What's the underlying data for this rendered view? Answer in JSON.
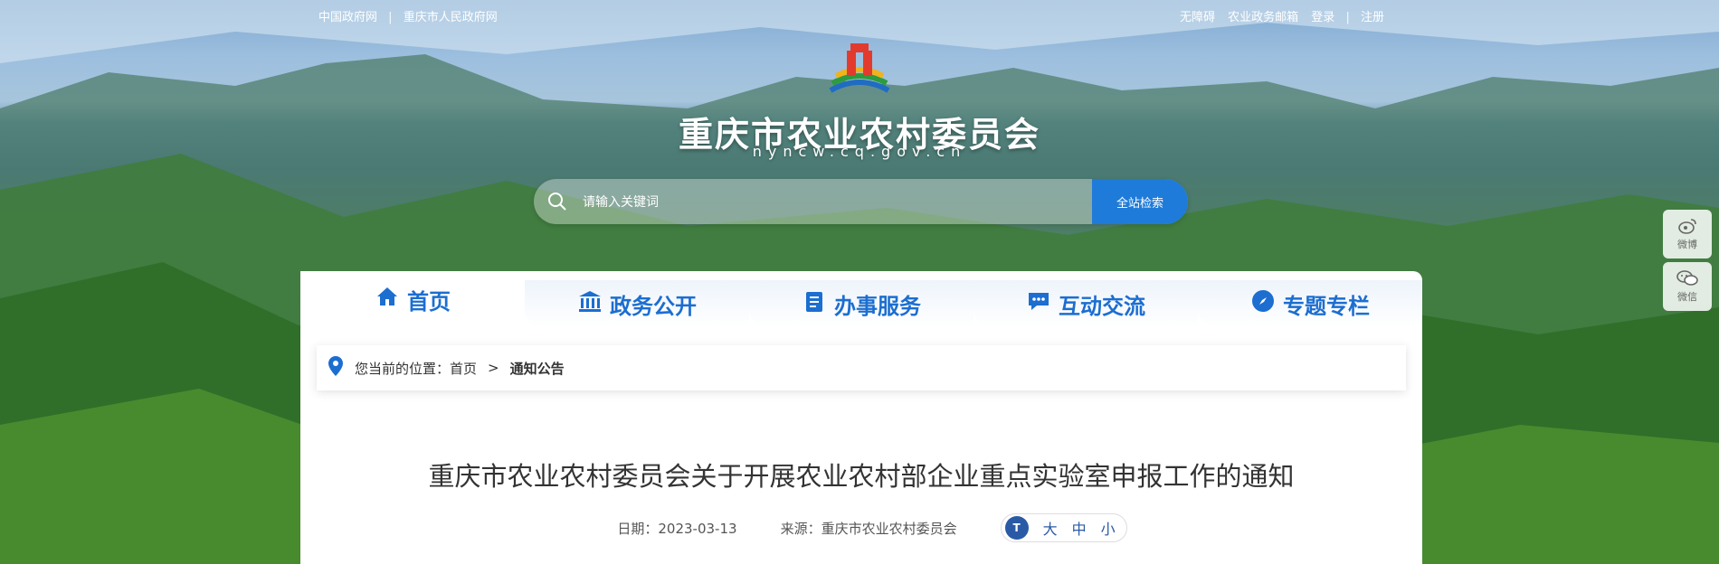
{
  "top_left_links": [
    "中国政府网",
    "重庆市人民政府网"
  ],
  "top_right_links": [
    "无障碍",
    "农业政务邮箱",
    "登录",
    "注册"
  ],
  "site": {
    "title": "重庆市农业农村委员会",
    "domain": "nyncw.cq.gov.cn"
  },
  "search": {
    "placeholder": "请输入关键词",
    "button_label": "全站检索"
  },
  "nav_tabs": [
    {
      "label": "首页",
      "icon": "home-icon"
    },
    {
      "label": "政务公开",
      "icon": "government-building-icon"
    },
    {
      "label": "办事服务",
      "icon": "clipboard-icon"
    },
    {
      "label": "互动交流",
      "icon": "chat-icon"
    },
    {
      "label": "专题专栏",
      "icon": "compass-icon"
    }
  ],
  "breadcrumb": {
    "prefix": "您当前的位置：",
    "home": "首页",
    "separator": ">",
    "current": "通知公告"
  },
  "article": {
    "title": "重庆市农业农村委员会关于开展农业农村部企业重点实验室申报工作的通知",
    "date_label": "日期：",
    "date": "2023-03-13",
    "source_label": "来源：",
    "source": "重庆市农业农村委员会",
    "font_icon_text": "T",
    "font_sizes": [
      "大",
      "中",
      "小"
    ]
  },
  "side_float": [
    {
      "label": "微博",
      "icon": "weibo-icon"
    },
    {
      "label": "微信",
      "icon": "wechat-icon"
    }
  ],
  "colors": {
    "accent": "#1c6ed0",
    "search_button": "#1f7bd9"
  }
}
